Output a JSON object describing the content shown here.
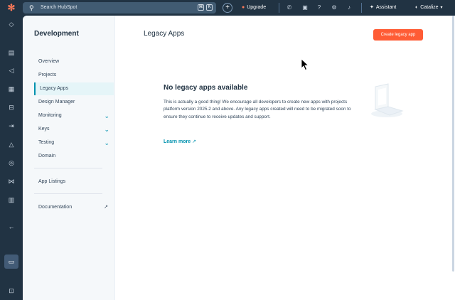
{
  "topbar": {
    "search_placeholder": "Search HubSpot",
    "kbd_1": "⌘",
    "kbd_2": "K",
    "upgrade_label": "Upgrade",
    "assistant_label": "Assistant",
    "account_label": "Catalize"
  },
  "subnav": {
    "title": "Development",
    "items": [
      {
        "label": "Overview"
      },
      {
        "label": "Projects"
      },
      {
        "label": "Legacy Apps"
      },
      {
        "label": "Design Manager"
      },
      {
        "label": "Monitoring"
      },
      {
        "label": "Keys"
      },
      {
        "label": "Testing"
      },
      {
        "label": "Domain"
      },
      {
        "label": "App Listings"
      },
      {
        "label": "Documentation"
      }
    ]
  },
  "main": {
    "title": "Legacy Apps",
    "create_button": "Create legacy app",
    "empty_title": "No legacy apps available",
    "empty_text": "This is actually a good thing! We encourage all developers to create new apps with projects platform version 2025.2 and above. Any legacy apps created will need to be migrated soon to ensure they continue to receive updates and support.",
    "learn_more": "Learn more"
  },
  "colors": {
    "accent": "#ff5c35",
    "link": "#0091ae",
    "chrome": "#213343"
  }
}
